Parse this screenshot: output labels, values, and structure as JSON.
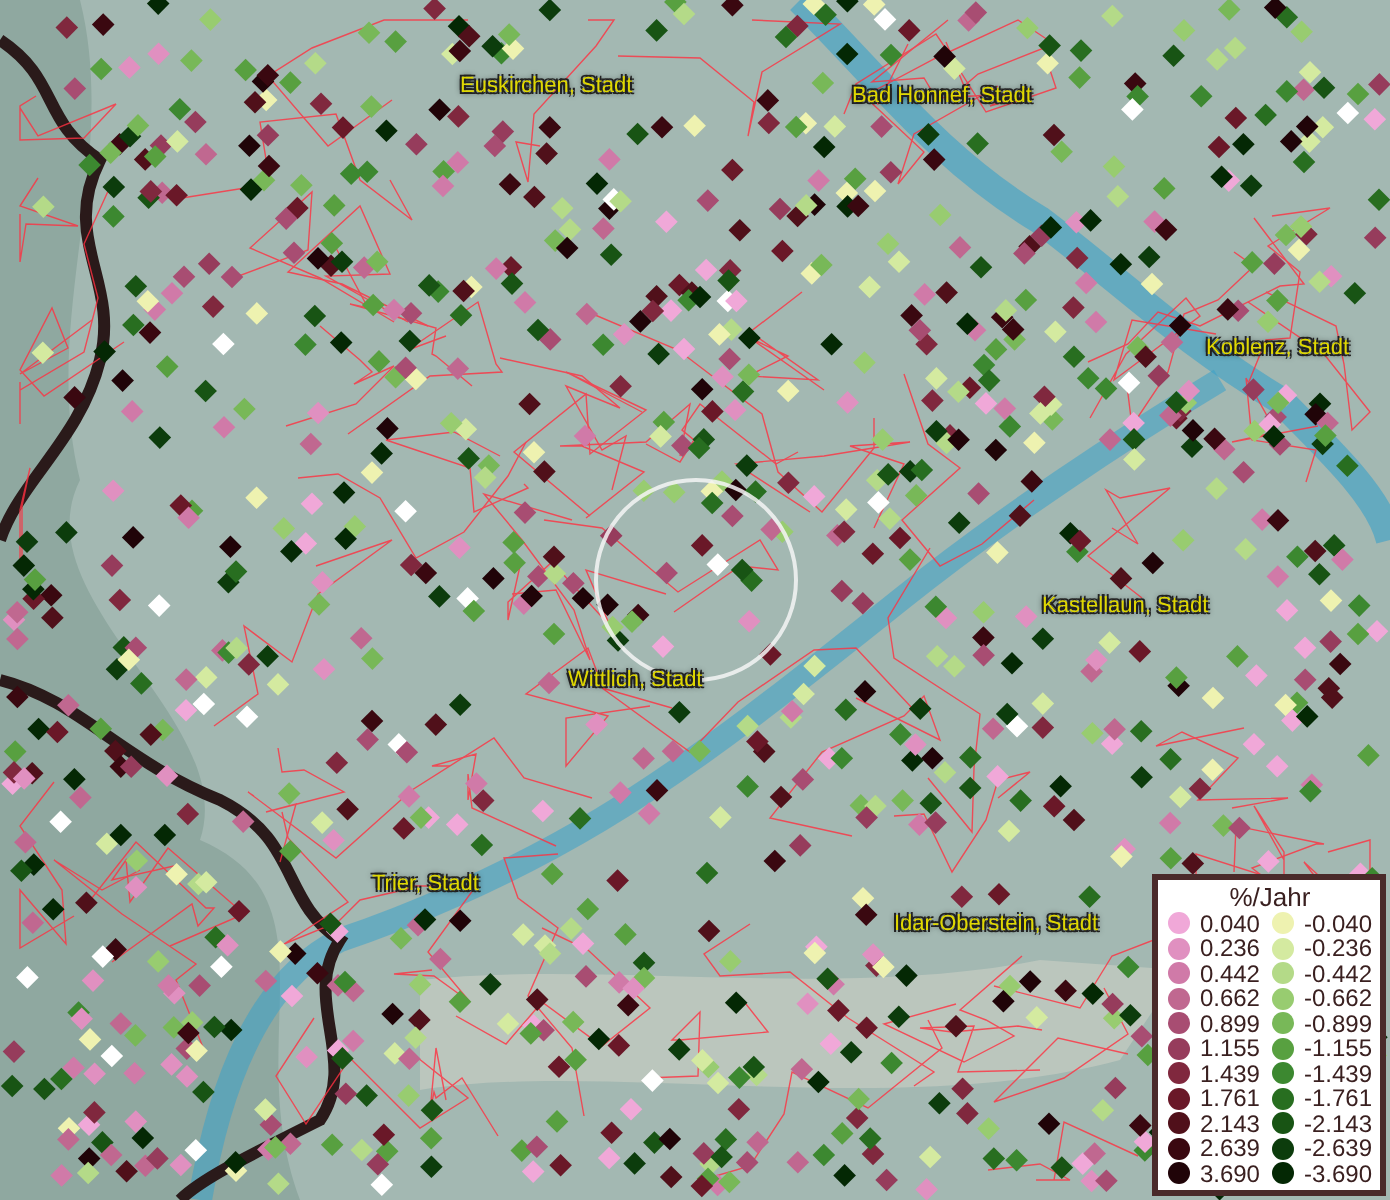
{
  "map": {
    "places": [
      {
        "name": "Euskirchen, Stadt"
      },
      {
        "name": "Bad Honnef, Stadt"
      },
      {
        "name": "Koblenz, Stadt"
      },
      {
        "name": "Kastellaun, Stadt"
      },
      {
        "name": "Wittlich, Stadt"
      },
      {
        "name": "Trier, Stadt"
      },
      {
        "name": "Idar-Oberstein, Stadt"
      }
    ]
  },
  "legend": {
    "title": "%/Jahr",
    "positive": [
      {
        "label": "0.040",
        "color": "#f0a8d8"
      },
      {
        "label": "0.236",
        "color": "#e090c0"
      },
      {
        "label": "0.442",
        "color": "#d07aa8"
      },
      {
        "label": "0.662",
        "color": "#c06890"
      },
      {
        "label": "0.899",
        "color": "#a84d72"
      },
      {
        "label": "1.155",
        "color": "#963c5c"
      },
      {
        "label": "1.439",
        "color": "#80283e"
      },
      {
        "label": "1.761",
        "color": "#6a1828"
      },
      {
        "label": "2.143",
        "color": "#50101a"
      },
      {
        "label": "2.639",
        "color": "#3a0810"
      },
      {
        "label": "3.690",
        "color": "#200408"
      }
    ],
    "negative": [
      {
        "label": "-0.040",
        "color": "#eef2b0"
      },
      {
        "label": "-0.236",
        "color": "#d4eaa0"
      },
      {
        "label": "-0.442",
        "color": "#b4da88"
      },
      {
        "label": "-0.662",
        "color": "#98cc70"
      },
      {
        "label": "-0.899",
        "color": "#78b858"
      },
      {
        "label": "-1.155",
        "color": "#58a040"
      },
      {
        "label": "-1.439",
        "color": "#3c8830"
      },
      {
        "label": "-1.761",
        "color": "#286e20"
      },
      {
        "label": "-2.143",
        "color": "#185414"
      },
      {
        "label": "-2.639",
        "color": "#0c3c0c"
      },
      {
        "label": "-3.690",
        "color": "#042804"
      }
    ]
  }
}
